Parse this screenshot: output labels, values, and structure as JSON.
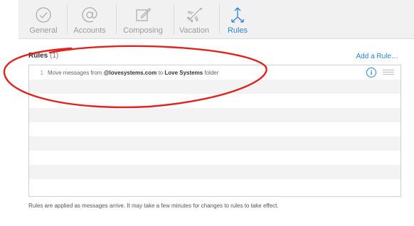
{
  "toolbar": {
    "items": [
      {
        "label": "General",
        "icon": "checkmark-circle-icon"
      },
      {
        "label": "Accounts",
        "icon": "at-sign-icon"
      },
      {
        "label": "Composing",
        "icon": "compose-icon"
      },
      {
        "label": "Vacation",
        "icon": "airplane-icon"
      },
      {
        "label": "Rules",
        "icon": "rules-arrows-icon",
        "active": true
      }
    ]
  },
  "rules": {
    "heading": "Rules",
    "count": "(1)",
    "add_label": "Add a Rule…",
    "list": [
      {
        "number": "1",
        "text_before": "Move messages from ",
        "sender": "@lovesystems.com",
        "text_middle": " to ",
        "folder": "Love Systems",
        "text_after": " folder",
        "info_glyph": "i"
      }
    ]
  },
  "footer": {
    "note": "Rules are applied as messages arrive. It may take a few minutes for changes to rules to take effect."
  },
  "colors": {
    "accent": "#2b84d6",
    "annotation_circle": "#e0231e",
    "toolbar_bg": "#f1f1f1"
  }
}
